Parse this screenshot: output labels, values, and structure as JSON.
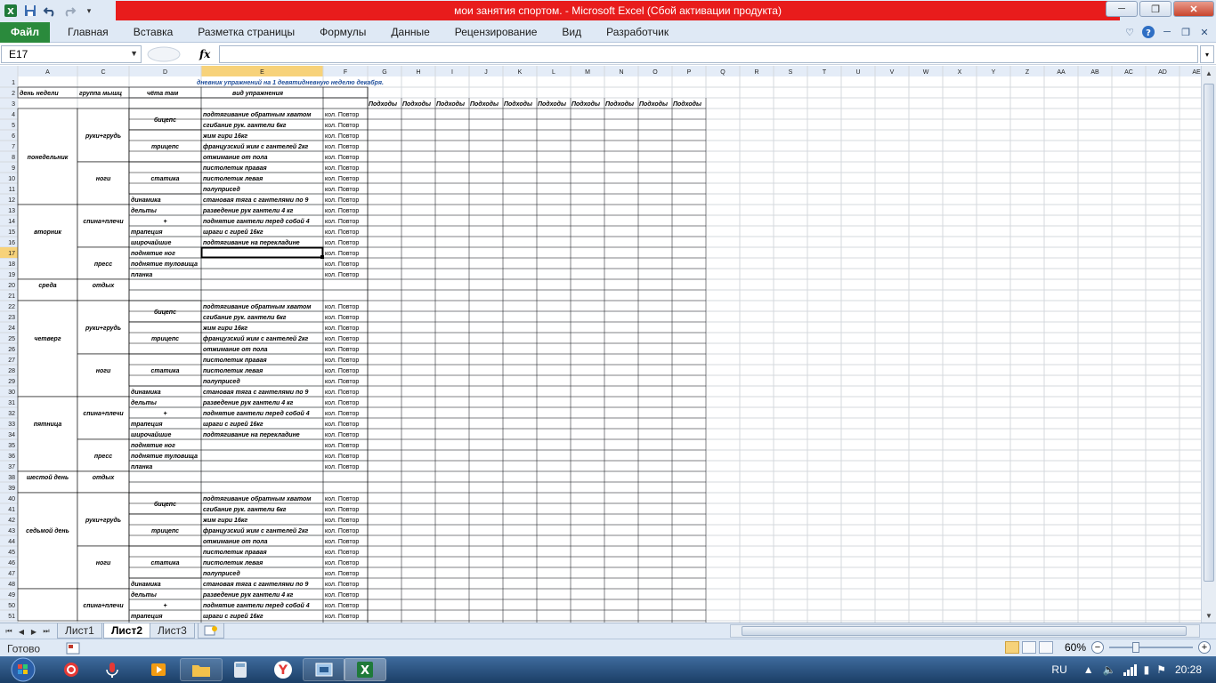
{
  "title": {
    "text": "мои занятия спортом.  -  Microsoft Excel (Сбой активации продукта)"
  },
  "ribbon": {
    "file": "Файл",
    "tabs": [
      "Главная",
      "Вставка",
      "Разметка страницы",
      "Формулы",
      "Данные",
      "Рецензирование",
      "Вид",
      "Разработчик"
    ]
  },
  "formula": {
    "namebox": "E17",
    "fx": "fx",
    "value": ""
  },
  "columns": [
    "A",
    "C",
    "D",
    "E",
    "F",
    "G",
    "H",
    "I",
    "J",
    "K",
    "L",
    "M",
    "N",
    "O",
    "P",
    "Q",
    "R",
    "S",
    "T",
    "U",
    "V",
    "W",
    "X",
    "Y",
    "Z",
    "AA",
    "AB",
    "AC",
    "AD",
    "AE"
  ],
  "sheet": {
    "rows": 51,
    "heading": "дневник упражнений на 1 девятидневную неделю декабря.",
    "headers": {
      "day": "день недели",
      "group": "группа мышц",
      "what": "чёта там",
      "exercise": "вид упражнения"
    },
    "set_label": "Подходы",
    "reps_label": "кол. Повтор",
    "days": [
      {
        "row": 8,
        "text": "понедельник"
      },
      {
        "row": 15,
        "text": "вторник"
      },
      {
        "row": 20,
        "text": "среда"
      },
      {
        "row": 25,
        "text": "четверг"
      },
      {
        "row": 33,
        "text": "пятница"
      },
      {
        "row": 38,
        "text": "шестой день"
      },
      {
        "row": 43,
        "text": "седьмой день"
      }
    ],
    "groups": [
      {
        "row": 6,
        "text": "руки+грудь"
      },
      {
        "row": 10,
        "text": "ноги"
      },
      {
        "row": 14,
        "text": "спина+плечи"
      },
      {
        "row": 18,
        "text": "пресс"
      },
      {
        "row": 20,
        "text": "отдых"
      },
      {
        "row": 24,
        "text": "руки+грудь"
      },
      {
        "row": 28,
        "text": "ноги"
      },
      {
        "row": 32,
        "text": "спина+плечи"
      },
      {
        "row": 36,
        "text": "пресс"
      },
      {
        "row": 38,
        "text": "отдых"
      },
      {
        "row": 42,
        "text": "руки+грудь"
      },
      {
        "row": 46,
        "text": "ноги"
      },
      {
        "row": 50,
        "text": "спина+плечи"
      }
    ],
    "what": [
      {
        "row": 4,
        "text": "бицепс",
        "center": true
      },
      {
        "row": 6,
        "text": "трицепс",
        "center": true
      },
      {
        "row": 9,
        "text": "статика",
        "center": true
      },
      {
        "row": 12,
        "text": "динамика"
      },
      {
        "row": 13,
        "text": "дельты"
      },
      {
        "row": 14,
        "text": "+",
        "center": true
      },
      {
        "row": 15,
        "text": "трапеция"
      },
      {
        "row": 16,
        "text": "широчайшие"
      },
      {
        "row": 17,
        "text": "поднятие ног"
      },
      {
        "row": 18,
        "text": "поднятие туловища"
      },
      {
        "row": 19,
        "text": "планка"
      },
      {
        "row": 22,
        "text": "бицепс",
        "center": true
      },
      {
        "row": 24,
        "text": "трицепс",
        "center": true
      },
      {
        "row": 27,
        "text": "статика",
        "center": true
      },
      {
        "row": 30,
        "text": "динамика"
      },
      {
        "row": 31,
        "text": "дельты"
      },
      {
        "row": 32,
        "text": "+",
        "center": true
      },
      {
        "row": 33,
        "text": "трапеция"
      },
      {
        "row": 34,
        "text": "широчайшие"
      },
      {
        "row": 35,
        "text": "поднятие ног"
      },
      {
        "row": 36,
        "text": "поднятие туловища"
      },
      {
        "row": 37,
        "text": "планка"
      },
      {
        "row": 40,
        "text": "бицепс",
        "center": true
      },
      {
        "row": 42,
        "text": "трицепс",
        "center": true
      },
      {
        "row": 45,
        "text": "статика",
        "center": true
      },
      {
        "row": 48,
        "text": "динамика"
      },
      {
        "row": 49,
        "text": "дельты"
      },
      {
        "row": 50,
        "text": "+",
        "center": true
      },
      {
        "row": 51,
        "text": "трапеция"
      }
    ],
    "exercises": {
      "4": "подтягивание обратным хватом",
      "5": "сгибание рук. гантели 6кг",
      "6": "жим гири 16кг",
      "7": "французский жим с гантелей 2кг",
      "8": "отжимание от пола",
      "9": "пистолетик правая",
      "10": "пистолетик левая",
      "11": "полуприсед",
      "12": "становая тяга с гантелями по 9",
      "13": "разведение рук гантели 4 кг",
      "14": "поднятие гантели перед собой 4",
      "15": "шраги с гирей 16кг",
      "16": "подтягивание на перекладине",
      "22": "подтягивание обратным хватом",
      "23": "сгибание рук. гантели 6кг",
      "24": "жим гири 16кг",
      "25": "французский жим с гантелей 2кг",
      "26": "отжимание от пола",
      "27": "пистолетик правая",
      "28": "пистолетик левая",
      "29": "полуприсед",
      "30": "становая тяга с гантелями по 9",
      "31": "разведение рук гантели 4 кг",
      "32": "поднятие гантели перед собой 4",
      "33": "шраги с гирей 16кг",
      "34": "подтягивание на перекладине",
      "40": "подтягивание обратным хватом",
      "41": "сгибание рук. гантели 6кг",
      "42": "жим гири 16кг",
      "43": "французский жим с гантелей 2кг",
      "44": "отжимание от пола",
      "45": "пистолетик правая",
      "46": "пистолетик левая",
      "47": "полуприсед",
      "48": "становая тяга с гантелями по 9",
      "49": "разведение рук гантели 4 кг",
      "50": "поднятие гантели перед собой 4",
      "51": "шраги с гирей 16кг"
    }
  },
  "sheets": {
    "tabs": [
      "Лист1",
      "Лист2",
      "Лист3"
    ],
    "active": "Лист2"
  },
  "status": {
    "text": "Готово",
    "zoom": "60%",
    "zoom_level": 0.6
  },
  "taskbar": {
    "lang": "RU",
    "time": "20:28"
  },
  "colors": {
    "title_band": "#e81c1c",
    "file_tab": "#2a8a3c",
    "heading_text": "#1f4e9b"
  }
}
